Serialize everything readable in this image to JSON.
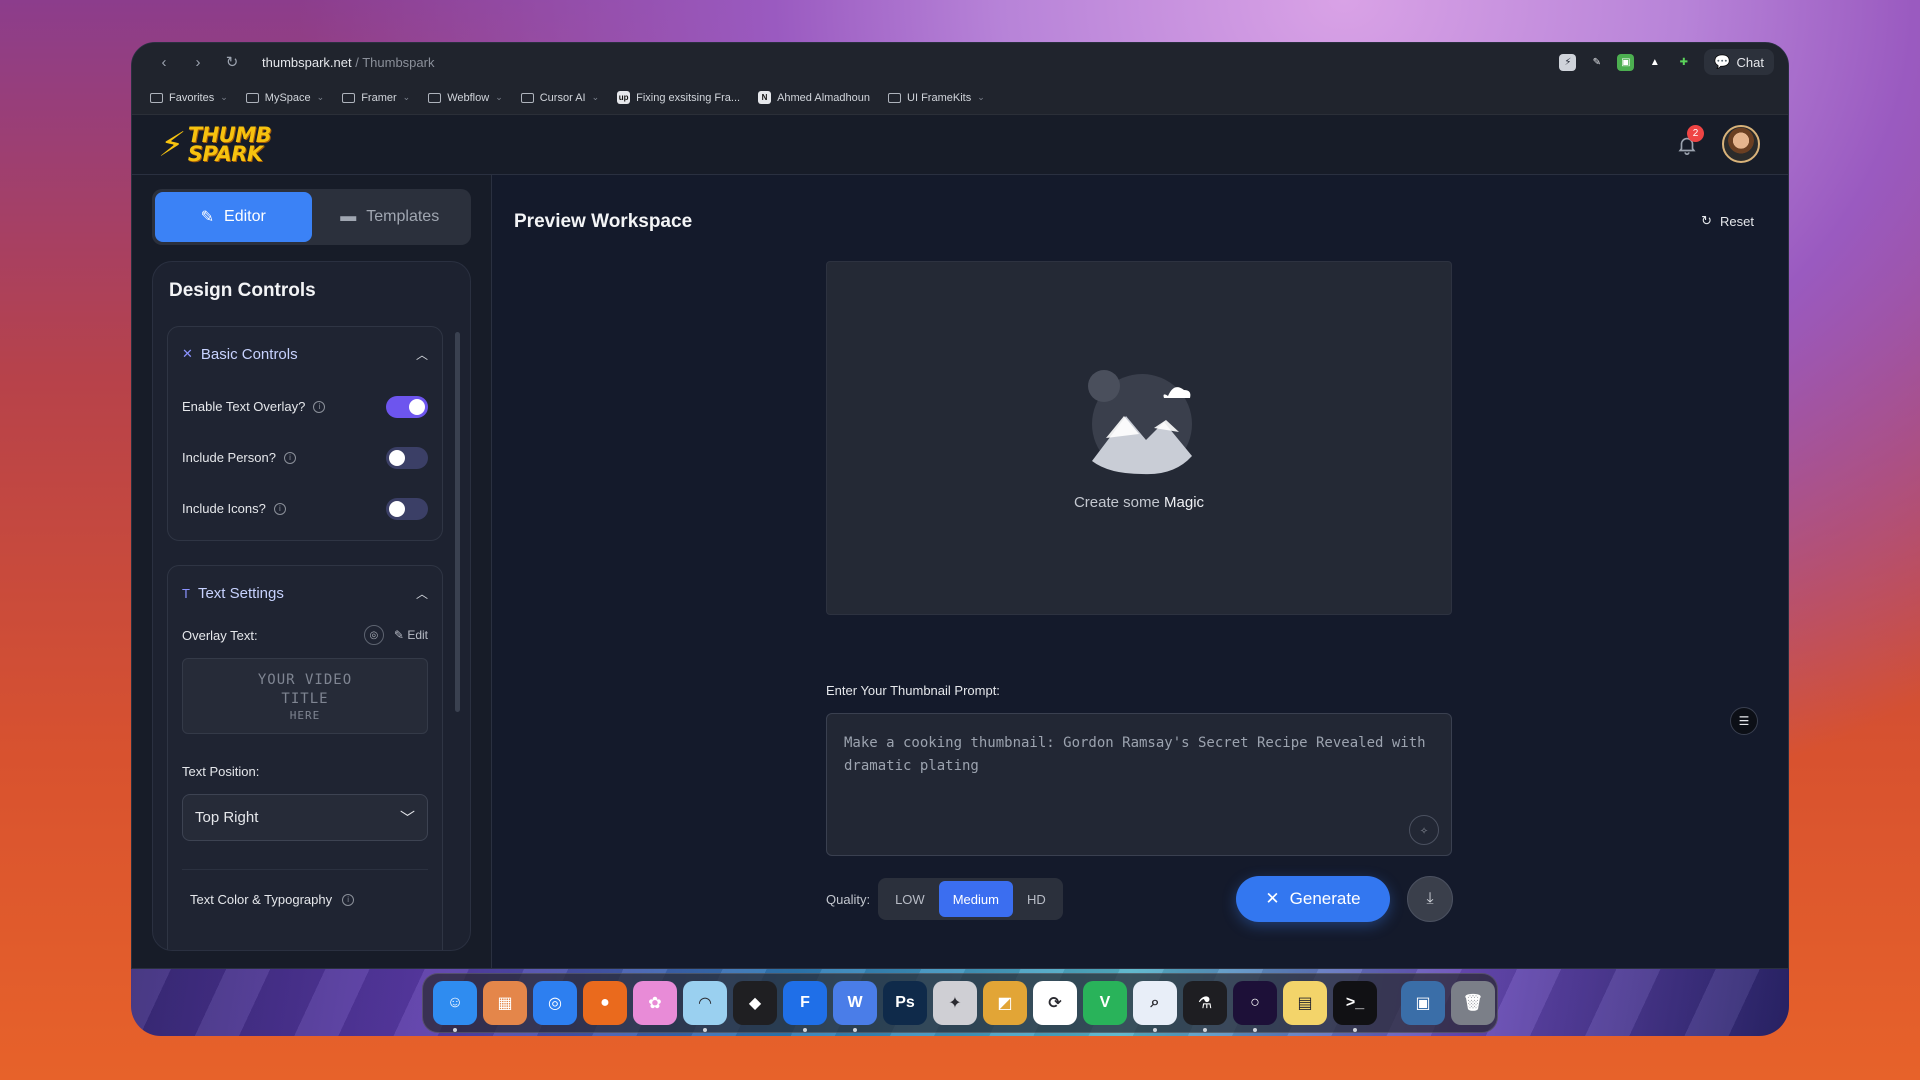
{
  "browser": {
    "url_host": "thumbspark.net",
    "url_sep": " / ",
    "url_title": "Thumbspark",
    "chat_label": "Chat",
    "bookmarks": [
      {
        "label": "Favorites",
        "type": "folder"
      },
      {
        "label": "MySpace",
        "type": "folder"
      },
      {
        "label": "Framer",
        "type": "folder"
      },
      {
        "label": "Webflow",
        "type": "folder"
      },
      {
        "label": "Cursor AI",
        "type": "folder"
      },
      {
        "label": "Fixing exsitsing Fra...",
        "type": "link",
        "badge": "up"
      },
      {
        "label": "Ahmed Almadhoun",
        "type": "link",
        "badge": "N"
      },
      {
        "label": "UI FrameKits",
        "type": "folder"
      }
    ]
  },
  "header": {
    "logo_line1": "THUMB",
    "logo_line2": "SPARK",
    "notification_count": "2"
  },
  "sidebar": {
    "tabs": [
      {
        "label": "Editor",
        "active": true
      },
      {
        "label": "Templates",
        "active": false
      }
    ],
    "controls_title": "Design Controls",
    "basic": {
      "title": "Basic Controls",
      "toggles": [
        {
          "label": "Enable Text Overlay?",
          "on": true
        },
        {
          "label": "Include Person?",
          "on": false
        },
        {
          "label": "Include Icons?",
          "on": false
        }
      ]
    },
    "text": {
      "title": "Text Settings",
      "overlay_label": "Overlay Text:",
      "edit_label": "Edit",
      "overlay_line1": "YOUR VIDEO",
      "overlay_line2": "TITLE",
      "overlay_line3": "HERE",
      "position_label": "Text Position:",
      "position_value": "Top Right",
      "typography_label": "Text Color & Typography"
    }
  },
  "main": {
    "title": "Preview Workspace",
    "reset_label": "Reset",
    "placeholder_prefix": "Create some ",
    "placeholder_emph": "Magic",
    "prompt_label": "Enter Your Thumbnail Prompt:",
    "prompt_value": "Make a cooking thumbnail: Gordon Ramsay's Secret Recipe Revealed with dramatic plating",
    "quality_label": "Quality:",
    "quality_options": [
      {
        "label": "LOW",
        "active": false
      },
      {
        "label": "Medium",
        "active": true
      },
      {
        "label": "HD",
        "active": false
      }
    ],
    "generate_label": "Generate"
  },
  "dock": {
    "apps": [
      {
        "name": "finder",
        "glyph": "☺",
        "color": "#2f8cf0",
        "running": true
      },
      {
        "name": "launchpad",
        "glyph": "▦",
        "color": "#e4864a",
        "running": false
      },
      {
        "name": "safari",
        "glyph": "◎",
        "color": "#2d7ff0",
        "running": false
      },
      {
        "name": "firefox",
        "glyph": "●",
        "color": "#ea6a1d",
        "running": false
      },
      {
        "name": "pixelmator",
        "glyph": "✿",
        "color": "#e88bd7",
        "running": false
      },
      {
        "name": "arc",
        "glyph": "◠",
        "color": "#9ad0f0",
        "running": true
      },
      {
        "name": "unity",
        "glyph": "◆",
        "color": "#1f1f22",
        "running": false
      },
      {
        "name": "framer",
        "glyph": "F",
        "color": "#1f6fe8",
        "running": true
      },
      {
        "name": "webflow",
        "glyph": "W",
        "color": "#4a7de8",
        "running": true
      },
      {
        "name": "photoshop",
        "glyph": "Ps",
        "color": "#0f2a4a",
        "running": false
      },
      {
        "name": "palette",
        "glyph": "✦",
        "color": "#cfcfd4",
        "running": false
      },
      {
        "name": "preview",
        "glyph": "◩",
        "color": "#e2a536",
        "running": false
      },
      {
        "name": "sync",
        "glyph": "⟳",
        "color": "#ffffff",
        "running": false
      },
      {
        "name": "vectorize",
        "glyph": "V",
        "color": "#29b35a",
        "running": false
      },
      {
        "name": "search",
        "glyph": "⌕",
        "color": "#e8eef8",
        "running": true
      },
      {
        "name": "flask",
        "glyph": "⚗",
        "color": "#1e1e22",
        "running": true
      },
      {
        "name": "orb",
        "glyph": "○",
        "color": "#1d1038",
        "running": true
      },
      {
        "name": "notes",
        "glyph": "▤",
        "color": "#f3d46a",
        "running": false
      },
      {
        "name": "terminal",
        "glyph": ">_",
        "color": "#111114",
        "running": true
      },
      {
        "name": "monitor",
        "glyph": "▣",
        "color": "#3a6ea8",
        "running": false
      },
      {
        "name": "trash",
        "glyph": "🗑",
        "color": "#7b7f88",
        "running": false
      }
    ]
  }
}
